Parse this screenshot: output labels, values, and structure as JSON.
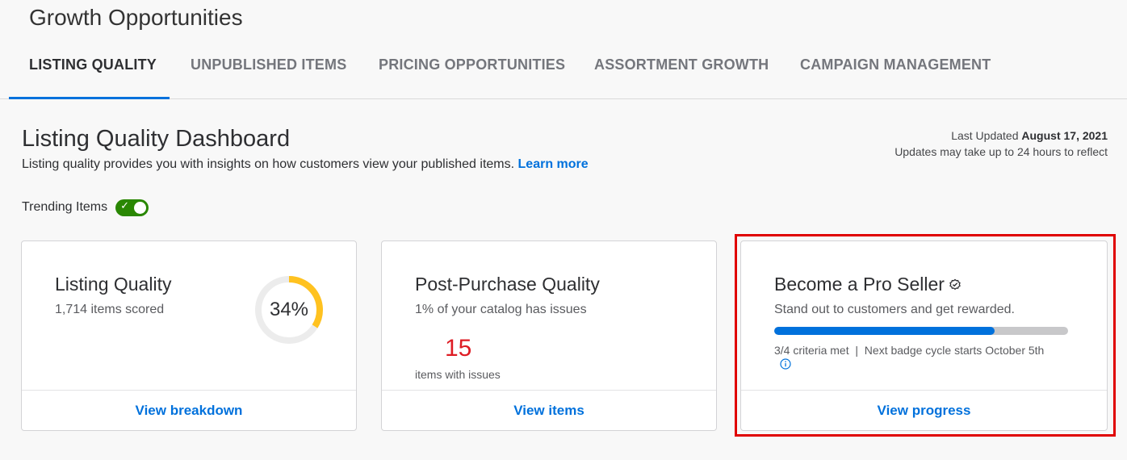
{
  "header": {
    "title": "Growth Opportunities"
  },
  "tabs": [
    {
      "label": "LISTING QUALITY"
    },
    {
      "label": "UNPUBLISHED ITEMS"
    },
    {
      "label": "PRICING OPPORTUNITIES"
    },
    {
      "label": "ASSORTMENT GROWTH"
    },
    {
      "label": "CAMPAIGN MANAGEMENT"
    }
  ],
  "dashboard": {
    "title": "Listing Quality Dashboard",
    "description": "Listing quality provides you with insights on how customers view your published items.",
    "learn_more": "Learn more",
    "last_updated_label": "Last Updated",
    "last_updated_date": "August 17, 2021",
    "update_note": "Updates may take up to 24 hours to reflect",
    "trending_label": "Trending Items",
    "trending_on": true
  },
  "cards": {
    "listing_quality": {
      "title": "Listing Quality",
      "subtitle": "1,714 items scored",
      "score_text": "34%",
      "score": 0.34,
      "link": "View breakdown",
      "ring_color": "#ffc220"
    },
    "post_purchase": {
      "title": "Post-Purchase Quality",
      "subtitle": "1% of your catalog has issues",
      "count": "15",
      "count_label": "items with issues",
      "link": "View items"
    },
    "pro_seller": {
      "title": "Become a Pro Seller",
      "subtitle": "Stand out to customers and get rewarded.",
      "progress": 0.75,
      "criteria": "3/4 criteria met",
      "next_cycle": "Next badge cycle starts October 5th",
      "link": "View progress"
    }
  },
  "colors": {
    "accent": "#0071dc",
    "success": "#2a8703",
    "error": "#de1c24",
    "highlight": "#e00000"
  }
}
